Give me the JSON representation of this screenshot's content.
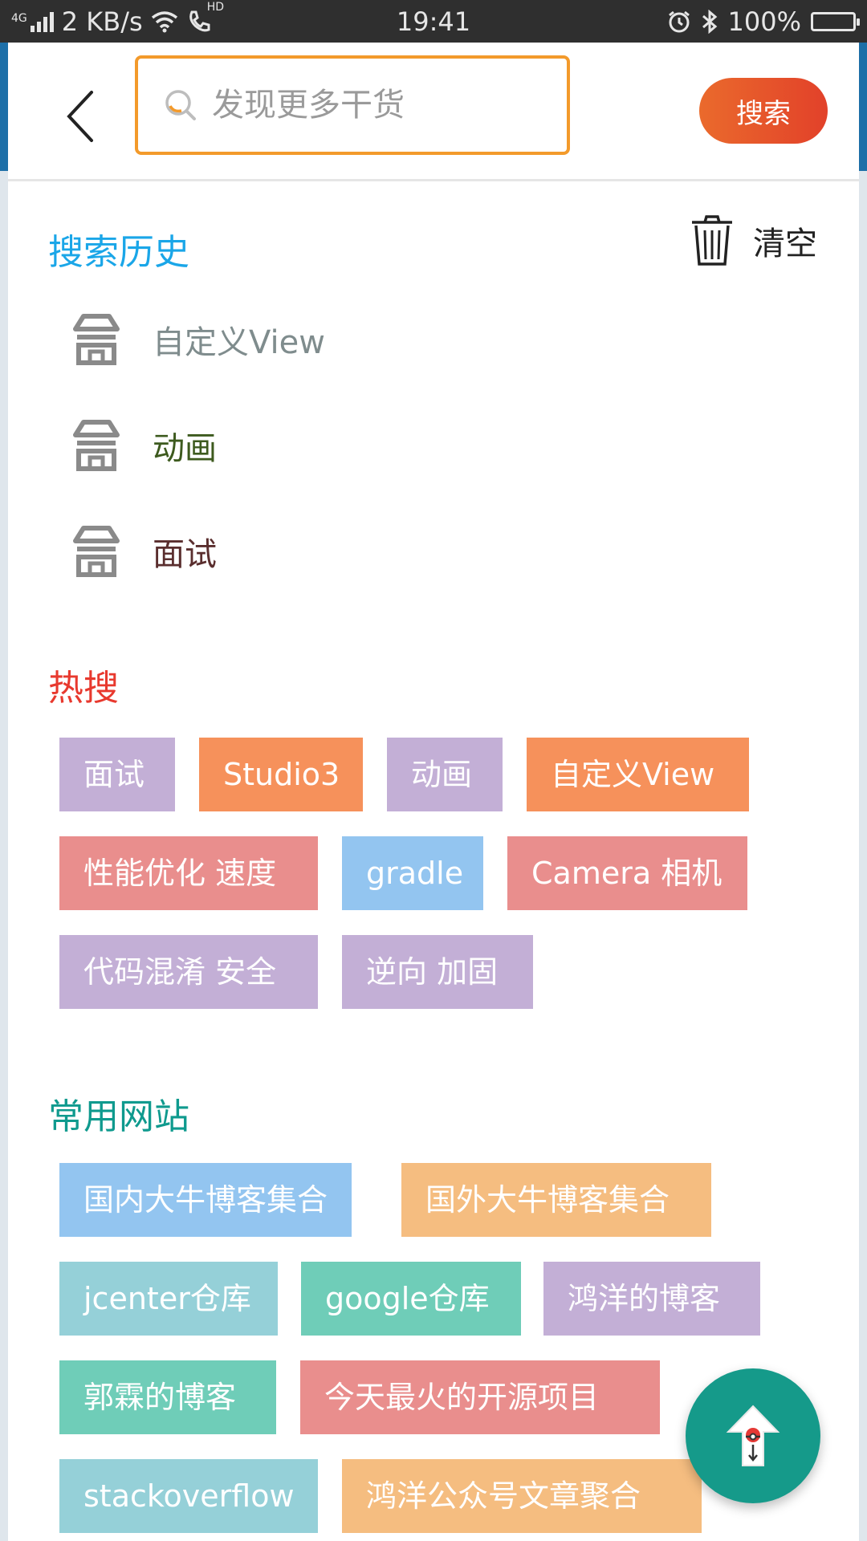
{
  "status_bar": {
    "network": "4G",
    "speed": "2 KB/s",
    "hd": "HD",
    "time": "19:41",
    "battery": "100%"
  },
  "search": {
    "placeholder": "发现更多干货",
    "button_label": "搜索",
    "accent_color": "#f39a2b"
  },
  "history": {
    "title": "搜索历史",
    "clear_label": "清空",
    "items": [
      {
        "label": "自定义View",
        "color": "#7f8c8d"
      },
      {
        "label": "动画",
        "color": "#3d5a1e"
      },
      {
        "label": "面试",
        "color": "#5a2e2e"
      }
    ]
  },
  "hot": {
    "title": "热搜",
    "tags": [
      {
        "label": "面试",
        "color": "purple"
      },
      {
        "label": "Studio3",
        "color": "orange"
      },
      {
        "label": "动画",
        "color": "purple"
      },
      {
        "label": "自定义View",
        "color": "orange"
      },
      {
        "label": "性能优化 速度",
        "color": "red"
      },
      {
        "label": "gradle",
        "color": "blue"
      },
      {
        "label": "Camera 相机",
        "color": "red"
      },
      {
        "label": "代码混淆 安全",
        "color": "purple"
      },
      {
        "label": "逆向 加固",
        "color": "purple"
      }
    ]
  },
  "sites": {
    "title": "常用网站",
    "tags": [
      {
        "label": "国内大牛博客集合",
        "color": "blue"
      },
      {
        "label": "国外大牛博客集合",
        "color": "peach"
      },
      {
        "label": "jcenter仓库",
        "color": "teal"
      },
      {
        "label": "google仓库",
        "color": "green"
      },
      {
        "label": "鸿洋的博客",
        "color": "purple"
      },
      {
        "label": "郭霖的博客",
        "color": "green"
      },
      {
        "label": "今天最火的开源项目",
        "color": "red"
      },
      {
        "label": "stackoverflow",
        "color": "teal"
      },
      {
        "label": "鸿洋公众号文章聚合",
        "color": "peach"
      }
    ]
  }
}
